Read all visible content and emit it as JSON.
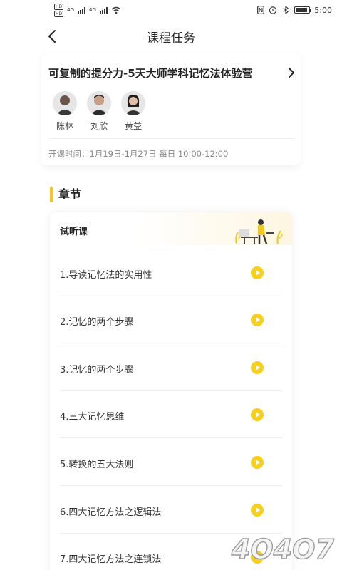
{
  "status_bar": {
    "hd1": "HD",
    "hd2": "HD",
    "net1": "4G",
    "net2": "4G",
    "time": "5:00"
  },
  "header": {
    "title": "课程任务"
  },
  "course": {
    "title": "可复制的提分力-5天大师学科记忆法体验营",
    "teachers": [
      {
        "name": "陈林"
      },
      {
        "name": "刘欣"
      },
      {
        "name": "黄益"
      }
    ],
    "schedule": "开课时间：1月19日-1月27日 每日 10:00-12:00"
  },
  "chapters": {
    "section_title": "章节",
    "trial_label": "试听课",
    "lessons": [
      {
        "title": "1.导读记忆法的实用性"
      },
      {
        "title": "2.记忆的两个步骤"
      },
      {
        "title": "3.记忆的两个步骤"
      },
      {
        "title": "4.三大记忆思维"
      },
      {
        "title": "5.转换的五大法则"
      },
      {
        "title": "6.四大记忆方法之逻辑法"
      },
      {
        "title": "7.四大记忆方法之连锁法"
      }
    ]
  },
  "watermark": {
    "text": "4O4O7"
  },
  "colors": {
    "accent": "#f2c51f",
    "play": "#f7cf20"
  }
}
